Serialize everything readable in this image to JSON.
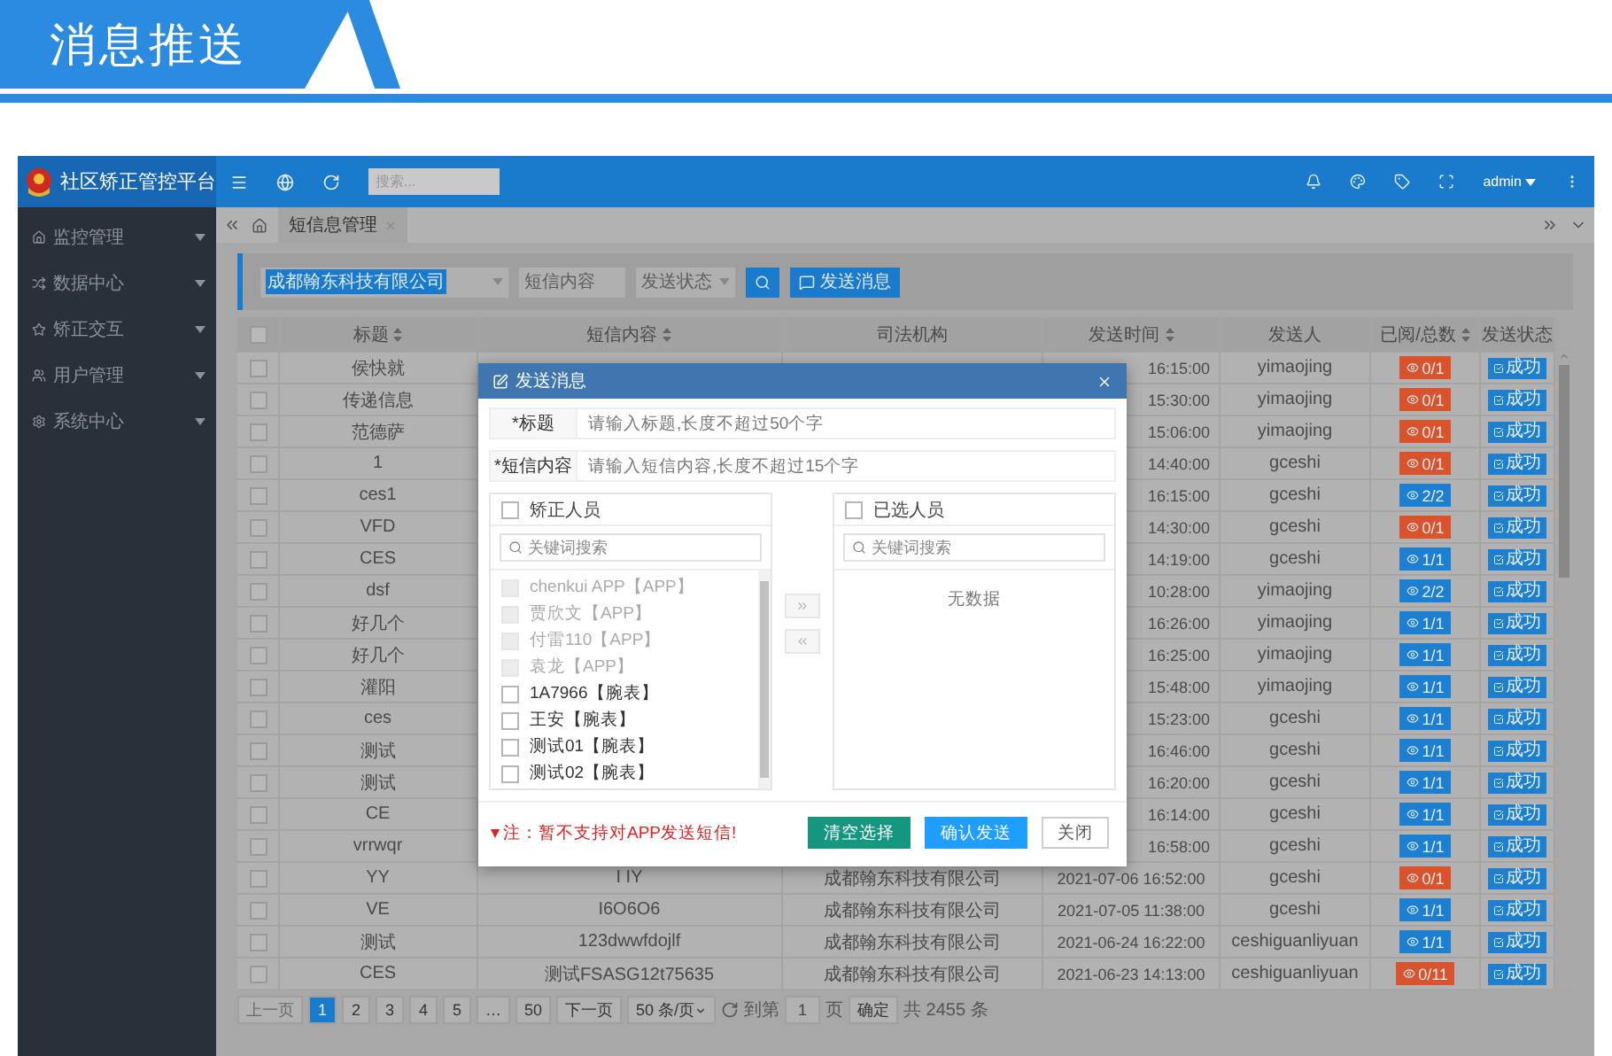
{
  "banner": {
    "title": "消息推送"
  },
  "app": {
    "title": "社区矫正管控平台",
    "search_placeholder": "搜索...",
    "user": "admin"
  },
  "sidebar": {
    "items": [
      {
        "label": "监控管理"
      },
      {
        "label": "数据中心"
      },
      {
        "label": "矫正交互"
      },
      {
        "label": "用户管理"
      },
      {
        "label": "系统中心"
      }
    ]
  },
  "tabs": [
    {
      "label": "短信息管理",
      "selected": true
    }
  ],
  "filters": {
    "org": "成都翰东科技有限公司",
    "content_placeholder": "短信内容",
    "status_placeholder": "发送状态",
    "send_button": "发送消息"
  },
  "table": {
    "header_checked": false,
    "columns": [
      {
        "label": "标题",
        "sortable": true
      },
      {
        "label": "短信内容",
        "sortable": true
      },
      {
        "label": "司法机构",
        "sortable": false
      },
      {
        "label": "发送时间",
        "sortable": true
      },
      {
        "label": "发送人",
        "sortable": false
      },
      {
        "label": "已阅/总数",
        "sortable": true
      },
      {
        "label": "发送状态",
        "sortable": false
      }
    ],
    "rows": [
      {
        "kind": "covered",
        "checked": false,
        "title": "侯快就",
        "time": "16:15:00",
        "sender": "yimaojing",
        "read": "0/1",
        "color": "#d9532c",
        "status": "成功"
      },
      {
        "kind": "covered",
        "checked": false,
        "title": "传递信息",
        "time": "15:30:00",
        "sender": "yimaojing",
        "read": "0/1",
        "color": "#d9532c",
        "status": "成功"
      },
      {
        "kind": "covered",
        "checked": false,
        "title": "范德萨",
        "time": "15:06:00",
        "sender": "yimaojing",
        "read": "0/1",
        "color": "#d9532c",
        "status": "成功"
      },
      {
        "kind": "covered",
        "checked": false,
        "title": "1",
        "time": "14:40:00",
        "sender": "gceshi",
        "read": "0/1",
        "color": "#d9532c",
        "status": "成功"
      },
      {
        "kind": "covered",
        "checked": false,
        "title": "ces1",
        "time": "16:15:00",
        "sender": "gceshi",
        "read": "2/2",
        "color": "#1c7fcf",
        "status": "成功"
      },
      {
        "kind": "covered",
        "checked": false,
        "title": "VFD",
        "time": "14:30:00",
        "sender": "gceshi",
        "read": "0/1",
        "color": "#d9532c",
        "status": "成功"
      },
      {
        "kind": "covered",
        "checked": false,
        "title": "CES",
        "time": "14:19:00",
        "sender": "gceshi",
        "read": "1/1",
        "color": "#1c7fcf",
        "status": "成功"
      },
      {
        "kind": "covered",
        "checked": false,
        "title": "dsf",
        "time": "10:28:00",
        "sender": "yimaojing",
        "read": "2/2",
        "color": "#1c7fcf",
        "status": "成功"
      },
      {
        "kind": "covered",
        "checked": false,
        "title": "好几个",
        "time": "16:26:00",
        "sender": "yimaojing",
        "read": "1/1",
        "color": "#1c7fcf",
        "status": "成功"
      },
      {
        "kind": "covered",
        "checked": false,
        "title": "好几个",
        "time": "16:25:00",
        "sender": "yimaojing",
        "read": "1/1",
        "color": "#1c7fcf",
        "status": "成功"
      },
      {
        "kind": "covered",
        "checked": false,
        "title": "灌阳",
        "time": "15:48:00",
        "sender": "yimaojing",
        "read": "1/1",
        "color": "#1c7fcf",
        "status": "成功"
      },
      {
        "kind": "covered",
        "checked": false,
        "title": "ces",
        "time": "15:23:00",
        "sender": "gceshi",
        "read": "1/1",
        "color": "#1c7fcf",
        "status": "成功"
      },
      {
        "kind": "covered",
        "checked": false,
        "title": "测试",
        "time": "16:46:00",
        "sender": "gceshi",
        "read": "1/1",
        "color": "#1c7fcf",
        "status": "成功"
      },
      {
        "kind": "covered",
        "checked": false,
        "title": "测试",
        "time": "16:20:00",
        "sender": "gceshi",
        "read": "1/1",
        "color": "#1c7fcf",
        "status": "成功"
      },
      {
        "kind": "covered",
        "checked": false,
        "title": "CE",
        "time": "16:14:00",
        "sender": "gceshi",
        "read": "1/1",
        "color": "#1c7fcf",
        "status": "成功"
      },
      {
        "kind": "covered",
        "checked": false,
        "title": "vrrwqr",
        "time": "16:58:00",
        "sender": "gceshi",
        "read": "1/1",
        "color": "#1c7fcf",
        "status": "成功"
      },
      {
        "kind": "full",
        "checked": false,
        "title": "YY",
        "content": "I IY",
        "org": "成都翰东科技有限公司",
        "time": "2021-07-06 16:52:00",
        "sender": "gceshi",
        "read": "0/1",
        "color": "#d9532c",
        "status": "成功"
      },
      {
        "kind": "full",
        "checked": false,
        "title": "VE",
        "content": "I6O6O6",
        "org": "成都翰东科技有限公司",
        "time": "2021-07-05 11:38:00",
        "sender": "gceshi",
        "read": "1/1",
        "color": "#1c7fcf",
        "status": "成功"
      },
      {
        "kind": "full",
        "checked": false,
        "title": "测试",
        "content": "123dwwfdojlf",
        "org": "成都翰东科技有限公司",
        "time": "2021-06-24 16:22:00",
        "sender": "ceshiguanliyuan",
        "read": "1/1",
        "color": "#1c7fcf",
        "status": "成功"
      },
      {
        "kind": "full",
        "checked": false,
        "title": "CES",
        "content": "测试FSASG12t75635",
        "org": "成都翰东科技有限公司",
        "time": "2021-06-23 14:13:00",
        "sender": "ceshiguanliyuan",
        "read": "0/11",
        "color": "#d9532c",
        "status": "成功"
      }
    ]
  },
  "pagination": {
    "prev": {
      "label": "上一页",
      "disabled": true
    },
    "pages": [
      {
        "label": "1",
        "selected": true
      },
      {
        "label": "2",
        "selected": false
      },
      {
        "label": "3",
        "selected": false
      },
      {
        "label": "4",
        "selected": false
      },
      {
        "label": "5",
        "selected": false
      },
      {
        "label": "…",
        "selected": false
      },
      {
        "label": "50",
        "selected": false
      }
    ],
    "next": {
      "label": "下一页",
      "disabled": false
    },
    "page_size": "50 条/页",
    "goto_label": "到第",
    "goto_value": "1",
    "page_unit": "页",
    "confirm": "确定",
    "total": "共 2455 条"
  },
  "dialog": {
    "title": "发送消息",
    "fields": [
      {
        "label": "*标题",
        "placeholder": "请输入标题,长度不超过50个字"
      },
      {
        "label": "*短信内容",
        "placeholder": "请输入短信内容,长度不超过15个字"
      }
    ],
    "left": {
      "title": "矫正人员",
      "checked": false,
      "search_placeholder": "关键词搜索",
      "items": [
        {
          "label": "chenkui APP【APP】",
          "disabled": true,
          "checked": false
        },
        {
          "label": "贾欣文【APP】",
          "disabled": true,
          "checked": false
        },
        {
          "label": "付雷110【APP】",
          "disabled": true,
          "checked": false
        },
        {
          "label": "袁龙【APP】",
          "disabled": true,
          "checked": false
        },
        {
          "label": "1A7966【腕表】",
          "disabled": false,
          "checked": false
        },
        {
          "label": "王安【腕表】",
          "disabled": false,
          "checked": false
        },
        {
          "label": "测试01【腕表】",
          "disabled": false,
          "checked": false
        },
        {
          "label": "测试02【腕表】",
          "disabled": false,
          "checked": false
        }
      ]
    },
    "right": {
      "title": "已选人员",
      "checked": false,
      "search_placeholder": "关键词搜索",
      "empty": "无数据"
    },
    "move_right_disabled": true,
    "move_left_disabled": true,
    "note": "注：暂不支持对APP发送短信!",
    "buttons": [
      {
        "label": "清空选择",
        "kind": "clear"
      },
      {
        "label": "确认发送",
        "kind": "confirm"
      },
      {
        "label": "关闭",
        "kind": "close"
      }
    ]
  }
}
